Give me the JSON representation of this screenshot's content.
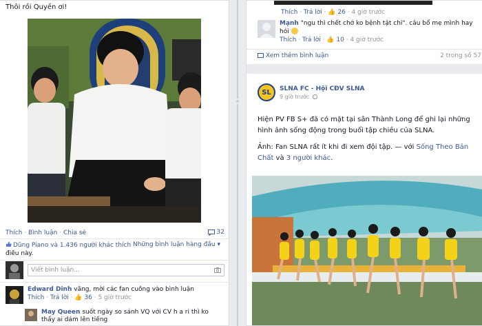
{
  "left_post": {
    "text": "Thôi rồi Quyền ơi!",
    "actions": [
      "Thích",
      "Bình luận",
      "Chia sẻ"
    ],
    "comment_count": "32",
    "likes_line1": "Dũng Piano và 1.436 người khác thích",
    "likes_line2": "điều này.",
    "top_comments_label": "Những bình luận hàng đầu ▾",
    "write_placeholder": "Viết bình luận...",
    "comments": [
      {
        "name": "Edward Dinh",
        "text": "vãng, mời các fan cuồng vào bình luận",
        "like": "Thích",
        "reply": "Trả lời",
        "likes": "36",
        "time": "5 giờ trước"
      },
      {
        "name": "May Queen",
        "text": "suốt ngày so sánh VQ với CV h a ri thì ko",
        "text2": "thấy ai dám lên tiếng"
      }
    ]
  },
  "right_col": {
    "prev_meta": {
      "like": "Thích",
      "reply": "Trả lời",
      "likes": "26",
      "time": "4 giờ trước"
    },
    "comment": {
      "name": "Mạnh",
      "text": "\"ngu thì chết chớ ko bệnh tật chi\". câu bổ mẹ mình hay",
      "text2": "hỏi",
      "like": "Thích",
      "reply": "Trả lời",
      "likes": "10",
      "time": "4 giờ trước"
    },
    "more_comments": "Xem thêm bình luận",
    "more_count": "2 trong số 57",
    "page": {
      "name": "SLNA FC - Hội CĐV SLNA",
      "time": "9 giờ trước",
      "logo_text": "SL"
    },
    "post": {
      "line1": "Hiện PV FB S+ đã có mặt tại sân Thành Long để ghi lại những",
      "line2": "hình ảnh sống động trong buổi tập chiều của SLNA.",
      "line3_prefix": "Ảnh: Fan SLNA rất ít khi đi xem đội tập. — với ",
      "tag1": "Sống Theo Bản",
      "tag1b": "Chất",
      "and": " và ",
      "tag2": "3 người khác",
      "dot": "."
    }
  }
}
